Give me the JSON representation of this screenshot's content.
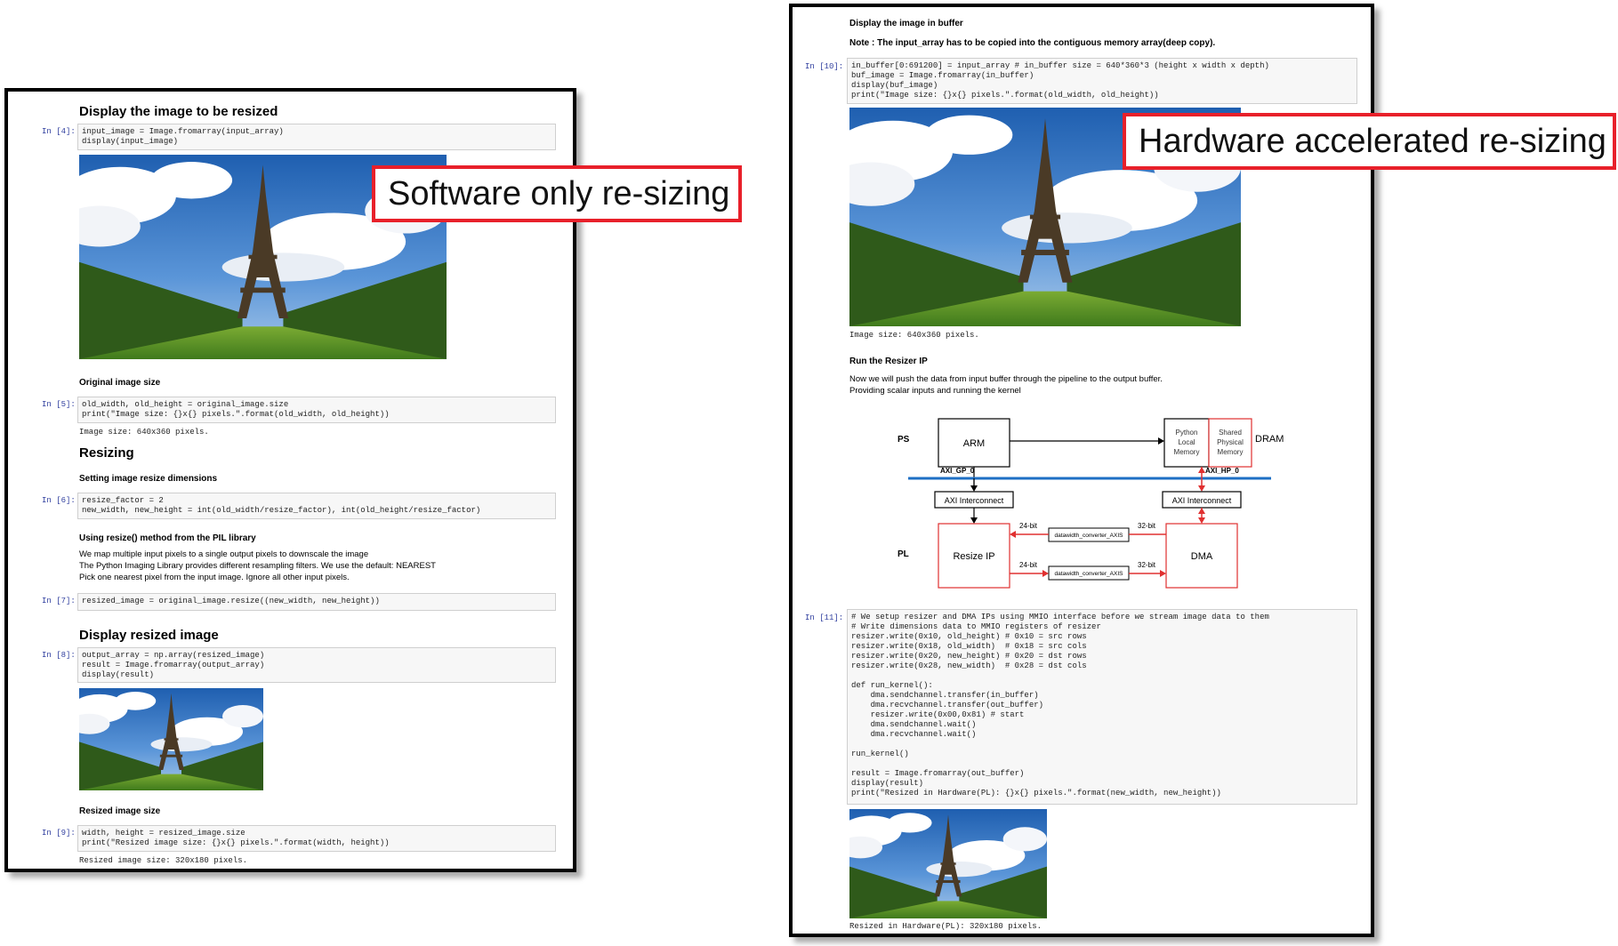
{
  "callouts": {
    "software": "Software only re-sizing",
    "hardware": "Hardware accelerated re-sizing"
  },
  "left": {
    "heading_display": "Display the image to be resized",
    "cell4": {
      "prompt": "In [4]:",
      "code": "input_image = Image.fromarray(input_array)\ndisplay(input_image)"
    },
    "orig_size_label": "Original image size",
    "cell5": {
      "prompt": "In [5]:",
      "code": "old_width, old_height = original_image.size\nprint(\"Image size: {}x{} pixels.\".format(old_width, old_height))",
      "output": "Image size: 640x360 pixels."
    },
    "heading_resizing": "Resizing",
    "setting_label": "Setting image resize dimensions",
    "cell6": {
      "prompt": "In [6]:",
      "code": "resize_factor = 2\nnew_width, new_height = int(old_width/resize_factor), int(old_height/resize_factor)"
    },
    "pil_label": "Using resize() method from the PIL library",
    "pil_text": [
      "We map multiple input pixels to a single output pixels to downscale the image",
      "The Python Imaging Library provides different resampling filters. We use the default: NEAREST",
      "Pick one nearest pixel from the input image. Ignore all other input pixels."
    ],
    "cell7": {
      "prompt": "In [7]:",
      "code": "resized_image = original_image.resize((new_width, new_height))"
    },
    "heading_resized": "Display resized image",
    "cell8": {
      "prompt": "In [8]:",
      "code": "output_array = np.array(resized_image)\nresult = Image.fromarray(output_array)\ndisplay(result)"
    },
    "resized_size_label": "Resized image size",
    "cell9": {
      "prompt": "In [9]:",
      "code": "width, height = resized_image.size\nprint(\"Resized image size: {}x{} pixels.\".format(width, height))",
      "output": "Resized image size: 320x180 pixels."
    }
  },
  "right": {
    "display_buffer_label": "Display the image in buffer",
    "note": "Note : The input_array has to be copied into the contiguous memory array(deep copy).",
    "cell10": {
      "prompt": "In [10]:",
      "code": "in_buffer[0:691200] = input_array # in_buffer size = 640*360*3 (height x width x depth)\nbuf_image = Image.fromarray(in_buffer)\ndisplay(buf_image)\nprint(\"Image size: {}x{} pixels.\".format(old_width, old_height))",
      "output": "Image size: 640x360 pixels."
    },
    "run_label": "Run the Resizer IP",
    "run_text": [
      "Now we will push the data from input buffer through the pipeline to the output buffer.",
      "Providing scalar inputs and running the kernel"
    ],
    "diagram": {
      "ps": "PS",
      "pl": "PL",
      "arm": "ARM",
      "plm": [
        "Python",
        "Local",
        "Memory"
      ],
      "spm": [
        "Shared",
        "Physical",
        "Memory"
      ],
      "dram": "DRAM",
      "axi_gp": "AXI_GP_0",
      "axi_hp": "AXI_HP_0",
      "ic1": "AXI Interconnect",
      "ic2": "AXI Interconnect",
      "resize": "Resize IP",
      "dma": "DMA",
      "conv": "datawidth_converter_AXIS",
      "b24": "24-bit",
      "b32": "32-bit"
    },
    "cell11": {
      "prompt": "In [11]:",
      "code": "# We setup resizer and DMA IPs using MMIO interface before we stream image data to them\n# Write dimensions data to MMIO registers of resizer\nresizer.write(0x10, old_height) # 0x10 = src rows\nresizer.write(0x18, old_width)  # 0x18 = src cols\nresizer.write(0x20, new_height) # 0x20 = dst rows\nresizer.write(0x28, new_width)  # 0x28 = dst cols\n\ndef run_kernel():\n    dma.sendchannel.transfer(in_buffer)\n    dma.recvchannel.transfer(out_buffer)\n    resizer.write(0x00,0x81) # start\n    dma.sendchannel.wait()\n    dma.recvchannel.wait()\n\nrun_kernel()\n\nresult = Image.fromarray(out_buffer)\ndisplay(result)\nprint(\"Resized in Hardware(PL): {}x{} pixels.\".format(new_width, new_height))",
      "output": "Resized in Hardware(PL): 320x180 pixels."
    }
  },
  "colors": {
    "callout_border": "#e8202a",
    "bus_blue": "#1e6fc4",
    "prompt_blue": "#303f9f",
    "diagram_red": "#e03030"
  }
}
